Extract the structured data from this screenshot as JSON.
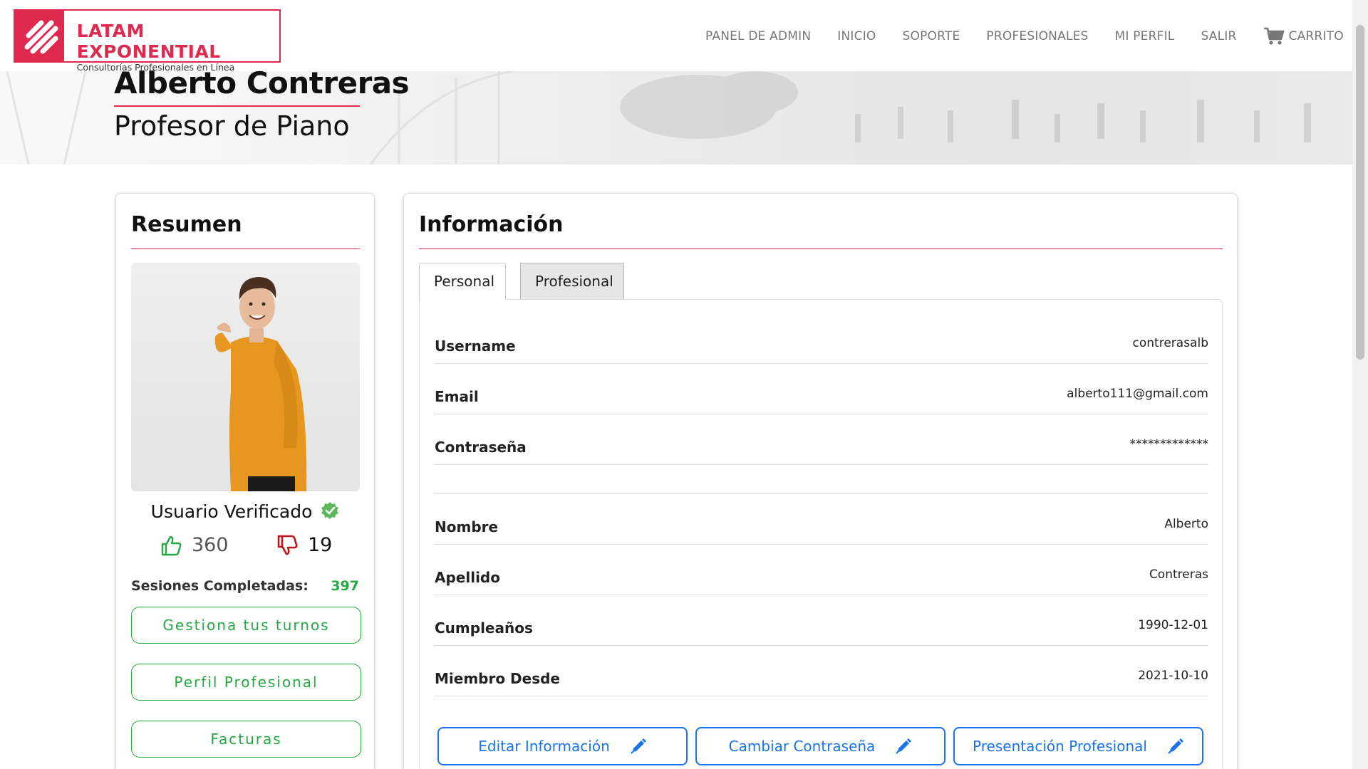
{
  "brand": {
    "title": "LATAM EXPONENTIAL",
    "subtitle": "Consultorías Profesionales en Línea",
    "accent_color": "#e0294e"
  },
  "nav": {
    "items": [
      {
        "label": "PANEL DE ADMIN"
      },
      {
        "label": "INICIO"
      },
      {
        "label": "SOPORTE"
      },
      {
        "label": "PROFESIONALES"
      },
      {
        "label": "MI PERFIL"
      },
      {
        "label": "SALIR"
      }
    ],
    "cart": {
      "label": "CARRITO",
      "icon": "cart-icon"
    }
  },
  "hero": {
    "name": "Alberto Contreras",
    "role": "Profesor de Piano"
  },
  "summary": {
    "title": "Resumen",
    "verified_label": "Usuario Verificado",
    "likes": "360",
    "dislikes": "19",
    "sessions_label": "Sesiones Completadas:",
    "sessions_value": "397",
    "buttons": {
      "turnos": "Gestiona tus turnos",
      "perfil": "Perfil Profesional",
      "facturas": "Facturas"
    },
    "success_color": "#28a745"
  },
  "info": {
    "title": "Información",
    "tabs": {
      "personal": "Personal",
      "profesional": "Profesional"
    },
    "fields": {
      "username": {
        "label": "Username",
        "value": "contrerasalb"
      },
      "email": {
        "label": "Email",
        "value": "alberto111@gmail.com"
      },
      "password": {
        "label": "Contraseña",
        "value": "*************"
      },
      "nombre": {
        "label": "Nombre",
        "value": "Alberto"
      },
      "apellido": {
        "label": "Apellido",
        "value": "Contreras"
      },
      "cumple": {
        "label": "Cumpleaños",
        "value": "1990-12-01"
      },
      "miembro": {
        "label": "Miembro Desde",
        "value": "2021-10-10"
      }
    },
    "actions": {
      "editar": "Editar Información",
      "cambiar": "Cambiar Contraseña",
      "presentacion": "Presentación Profesional"
    },
    "action_color": "#1a73e8"
  }
}
